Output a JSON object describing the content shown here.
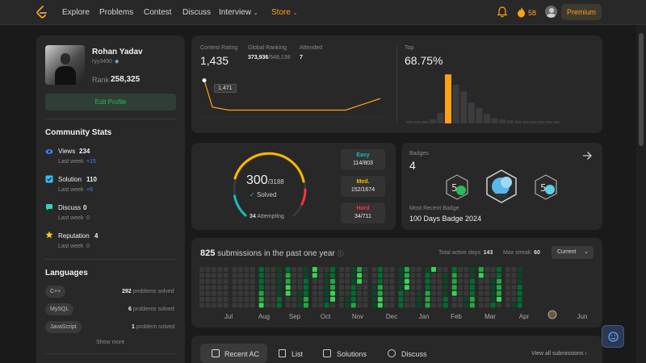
{
  "nav": {
    "links": [
      "Explore",
      "Problems",
      "Contest",
      "Discuss",
      "Interview",
      "Store"
    ],
    "streak": "58",
    "premium": "Premium"
  },
  "profile": {
    "name": "Rohan Yadav",
    "username": "ryy3490",
    "rank_label": "Rank",
    "rank": "258,325",
    "edit_button": "Edit Profile"
  },
  "community": {
    "title": "Community Stats",
    "stats": [
      {
        "label": "Views",
        "value": "234",
        "sub": "Last week",
        "delta": "+15",
        "color": "#3b82f6"
      },
      {
        "label": "Solution",
        "value": "110",
        "sub": "Last week",
        "delta": "+6",
        "color": "#38bdf8"
      },
      {
        "label": "Discuss",
        "value": "0",
        "sub": "Last week",
        "delta": "0",
        "color": "#2dd4bf"
      },
      {
        "label": "Reputation",
        "value": "4",
        "sub": "Last week",
        "delta": "0",
        "color": "#facc15"
      }
    ]
  },
  "languages": {
    "title": "Languages",
    "items": [
      {
        "name": "C++",
        "count": "292",
        "suffix": "problems solved"
      },
      {
        "name": "MySQL",
        "count": "6",
        "suffix": "problems solved"
      },
      {
        "name": "JavaScript",
        "count": "1",
        "suffix": "problem solved"
      }
    ],
    "show_more": "Show more"
  },
  "contest": {
    "rating_label": "Contest Rating",
    "rating": "1,435",
    "global_label": "Global Ranking",
    "global_rank": "373,936",
    "global_total": "/548,138",
    "attended_label": "Attended",
    "attended": "7",
    "tooltip": "1,471",
    "top_label": "Top",
    "top_value": "68.75%",
    "rating_points": [
      1471,
      1418,
      1412,
      1412,
      1412,
      1412,
      1435
    ],
    "histogram": [
      0.03,
      0.03,
      0.05,
      0.08,
      0.2,
      0.95,
      0.75,
      0.62,
      0.4,
      0.3,
      0.18,
      0.1,
      0.08,
      0.06,
      0.05,
      0.04,
      0.04,
      0.03,
      0.03,
      0.03
    ]
  },
  "solved": {
    "solved": "300",
    "total": "/3188",
    "solved_label": "Solved",
    "attempting": "34",
    "attempting_label": "Attempting",
    "easy_label": "Easy",
    "easy": "114/803",
    "medium_label": "Med.",
    "medium": "152/1674",
    "hard_label": "Hard",
    "hard": "34/711",
    "colors": {
      "easy": "#1cbaba",
      "medium": "#ffb700",
      "hard": "#f63737"
    }
  },
  "badges": {
    "title": "Badges",
    "count": "4",
    "recent_label": "Most Recent Badge",
    "recent": "100 Days Badge 2024"
  },
  "submissions": {
    "count": "825",
    "text": "submissions in the past one year",
    "active_label": "Total active days:",
    "active": "143",
    "streak_label": "Max streak:",
    "streak": "60",
    "select": "Current",
    "months": [
      "Jul",
      "Aug",
      "Sep",
      "Oct",
      "Nov",
      "Dec",
      "Jan",
      "Feb",
      "Mar",
      "Apr",
      "Jun"
    ]
  },
  "tabs": {
    "recent": "Recent AC",
    "list": "List",
    "solutions": "Solutions",
    "discuss": "Discuss",
    "view_all": "View all submissions"
  }
}
